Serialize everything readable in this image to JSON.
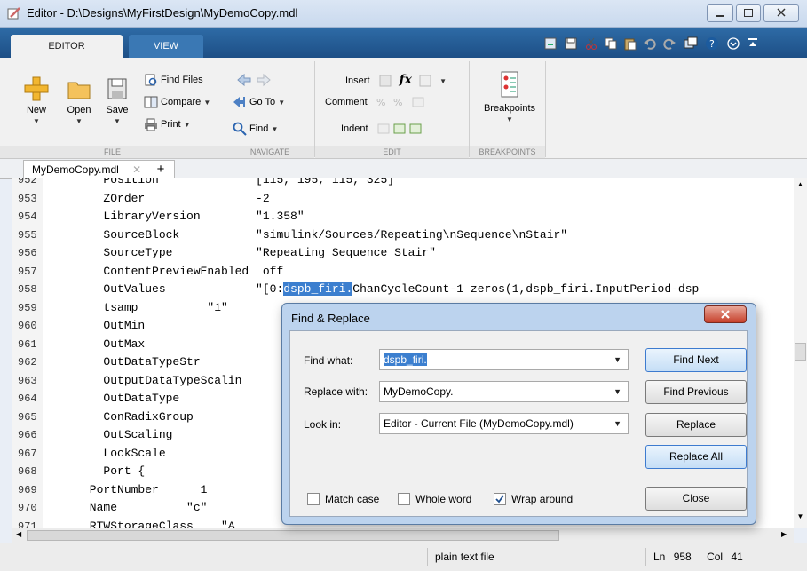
{
  "window": {
    "title": "Editor - D:\\Designs\\MyFirstDesign\\MyDemoCopy.mdl"
  },
  "ribbon": {
    "tabs": [
      "EDITOR",
      "VIEW"
    ],
    "file": {
      "new": "New",
      "open": "Open",
      "save": "Save",
      "find_files": "Find Files",
      "compare": "Compare",
      "print": "Print",
      "label": "FILE"
    },
    "navigate": {
      "go_to": "Go To",
      "find": "Find",
      "label": "NAVIGATE"
    },
    "edit": {
      "insert": "Insert",
      "comment": "Comment",
      "indent": "Indent",
      "label": "EDIT",
      "fx": "fx"
    },
    "breakpoints": {
      "button": "Breakpoints",
      "label": "BREAKPOINTS"
    }
  },
  "document_tab": {
    "label": "MyDemoCopy.mdl",
    "add": "+"
  },
  "editor": {
    "lines": [
      {
        "num": "952",
        "text": "        Position              [115, 195, 115, 325]"
      },
      {
        "num": "953",
        "text": "        ZOrder                -2"
      },
      {
        "num": "954",
        "text": "        LibraryVersion        \"1.358\""
      },
      {
        "num": "955",
        "text": "        SourceBlock           \"simulink/Sources/Repeating\\nSequence\\nStair\""
      },
      {
        "num": "956",
        "text": "        SourceType            \"Repeating Sequence Stair\""
      },
      {
        "num": "957",
        "text": "        ContentPreviewEnabled  off"
      },
      {
        "num": "958",
        "text": "        OutValues             \"[0:dspb_firi.ChanCycleCount-1 zeros(1,dspb_firi.InputPeriod-dsp"
      },
      {
        "num": "959",
        "text": "        tsamp          \"1\""
      },
      {
        "num": "960",
        "text": "        OutMin"
      },
      {
        "num": "961",
        "text": "        OutMax"
      },
      {
        "num": "962",
        "text": "        OutDataTypeStr"
      },
      {
        "num": "963",
        "text": "        OutputDataTypeScalin"
      },
      {
        "num": "964",
        "text": "        OutDataType"
      },
      {
        "num": "965",
        "text": "        ConRadixGroup"
      },
      {
        "num": "966",
        "text": "        OutScaling"
      },
      {
        "num": "967",
        "text": "        LockScale"
      },
      {
        "num": "968",
        "text": "        Port {"
      },
      {
        "num": "969",
        "text": "      PortNumber      1"
      },
      {
        "num": "970",
        "text": "      Name          \"c\""
      },
      {
        "num": "971",
        "text": "      RTWStorageClass    \"A"
      }
    ],
    "line958": {
      "prefix": "        OutValues             \"[0:",
      "selected": "dspb_firi.",
      "suffix": "ChanCycleCount-1 zeros(1,dspb_firi.InputPeriod-dsp"
    }
  },
  "status": {
    "file_type": "plain text file",
    "ln_label": "Ln",
    "ln": "958",
    "col_label": "Col",
    "col": "41"
  },
  "dialog": {
    "title": "Find & Replace",
    "find_label": "Find what:",
    "find_value": "dspb_firi.",
    "replace_label": "Replace with:",
    "replace_value": "MyDemoCopy.",
    "look_label": "Look in:",
    "look_value": "Editor - Current File (MyDemoCopy.mdl)",
    "buttons": {
      "find_next": "Find Next",
      "find_previous": "Find Previous",
      "replace": "Replace",
      "replace_all": "Replace All",
      "close": "Close"
    },
    "options": {
      "match_case": "Match case",
      "whole_word": "Whole word",
      "wrap_around": "Wrap around"
    }
  }
}
